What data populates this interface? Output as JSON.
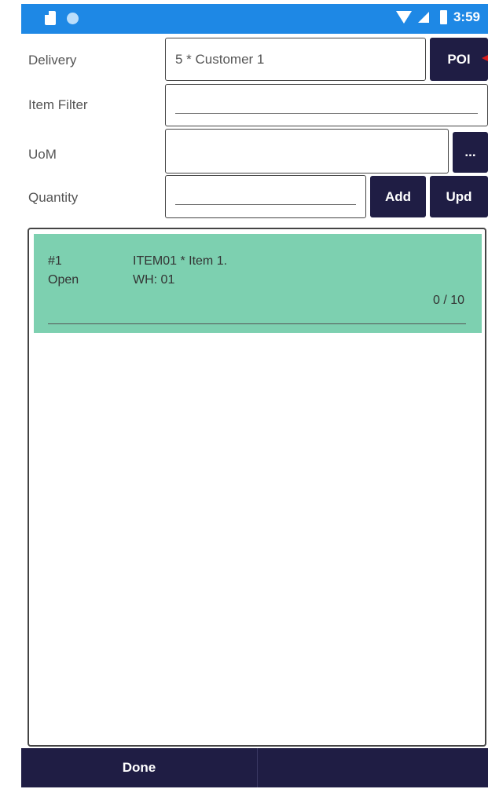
{
  "status_bar": {
    "time": "3:59"
  },
  "form": {
    "delivery_label": "Delivery",
    "delivery_value": "5 * Customer 1",
    "poi_button": "POI",
    "item_filter_label": "Item Filter",
    "item_filter_value": "",
    "uom_label": "UoM",
    "uom_value": "",
    "uom_button": "...",
    "quantity_label": "Quantity",
    "quantity_value": "",
    "add_button": "Add",
    "upd_button": "Upd"
  },
  "items": [
    {
      "number": "#1",
      "status": "Open",
      "title": "ITEM01 * Item 1.",
      "warehouse": "WH: 01",
      "progress": "0 / 10"
    }
  ],
  "bottom_bar": {
    "done_label": "Done"
  },
  "colors": {
    "status_bar": "#1e88e5",
    "button_bg": "#1f1d44",
    "item_bg": "#7dd0b0",
    "accent_arrow": "#d81b1b"
  }
}
